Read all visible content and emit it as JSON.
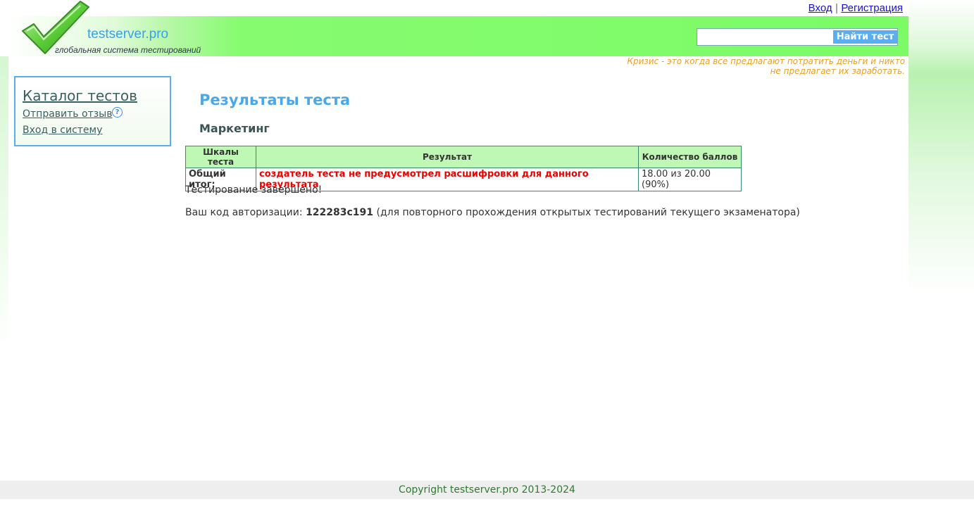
{
  "auth": {
    "login": "Вход",
    "separator": "|",
    "register": "Регистрация"
  },
  "header": {
    "site_name": "testserver.pro",
    "tagline": "глобальная система тестирований",
    "search_placeholder": "",
    "search_button": "Найти тест"
  },
  "quote": {
    "line1": "Кризис - это когда все предлагают потратить деньги и никто",
    "line2": "не предлагает их заработать."
  },
  "sidebar": {
    "catalog": "Каталог тестов",
    "feedback": "Отправить отзыв",
    "help": "?",
    "login": "Вход в систему"
  },
  "main": {
    "title": "Результаты теста",
    "test_name": "Маркетинг",
    "table": {
      "headers": [
        "Шкалы теста",
        "Результат",
        "Количество баллов"
      ],
      "row": {
        "scale": "Общий итог:",
        "result": "создатель теста не предусмотрел расшифровки для данного результата",
        "score": "18.00 из 20.00 (90%)"
      }
    },
    "done": "Тестирование завершено!",
    "auth_prefix": "Ваш код авторизации: ",
    "auth_code": "122283c191",
    "auth_suffix": " (для повторного прохождения открытых тестирований текущего экзаменатора)"
  },
  "footer": {
    "copyright": "Copyright testserver.pro 2013-2024"
  },
  "colors": {
    "accent": "#4aa8ea",
    "header_green": "#7cfb66",
    "warning_red": "#ee0000",
    "quote_orange": "#e8a020"
  }
}
